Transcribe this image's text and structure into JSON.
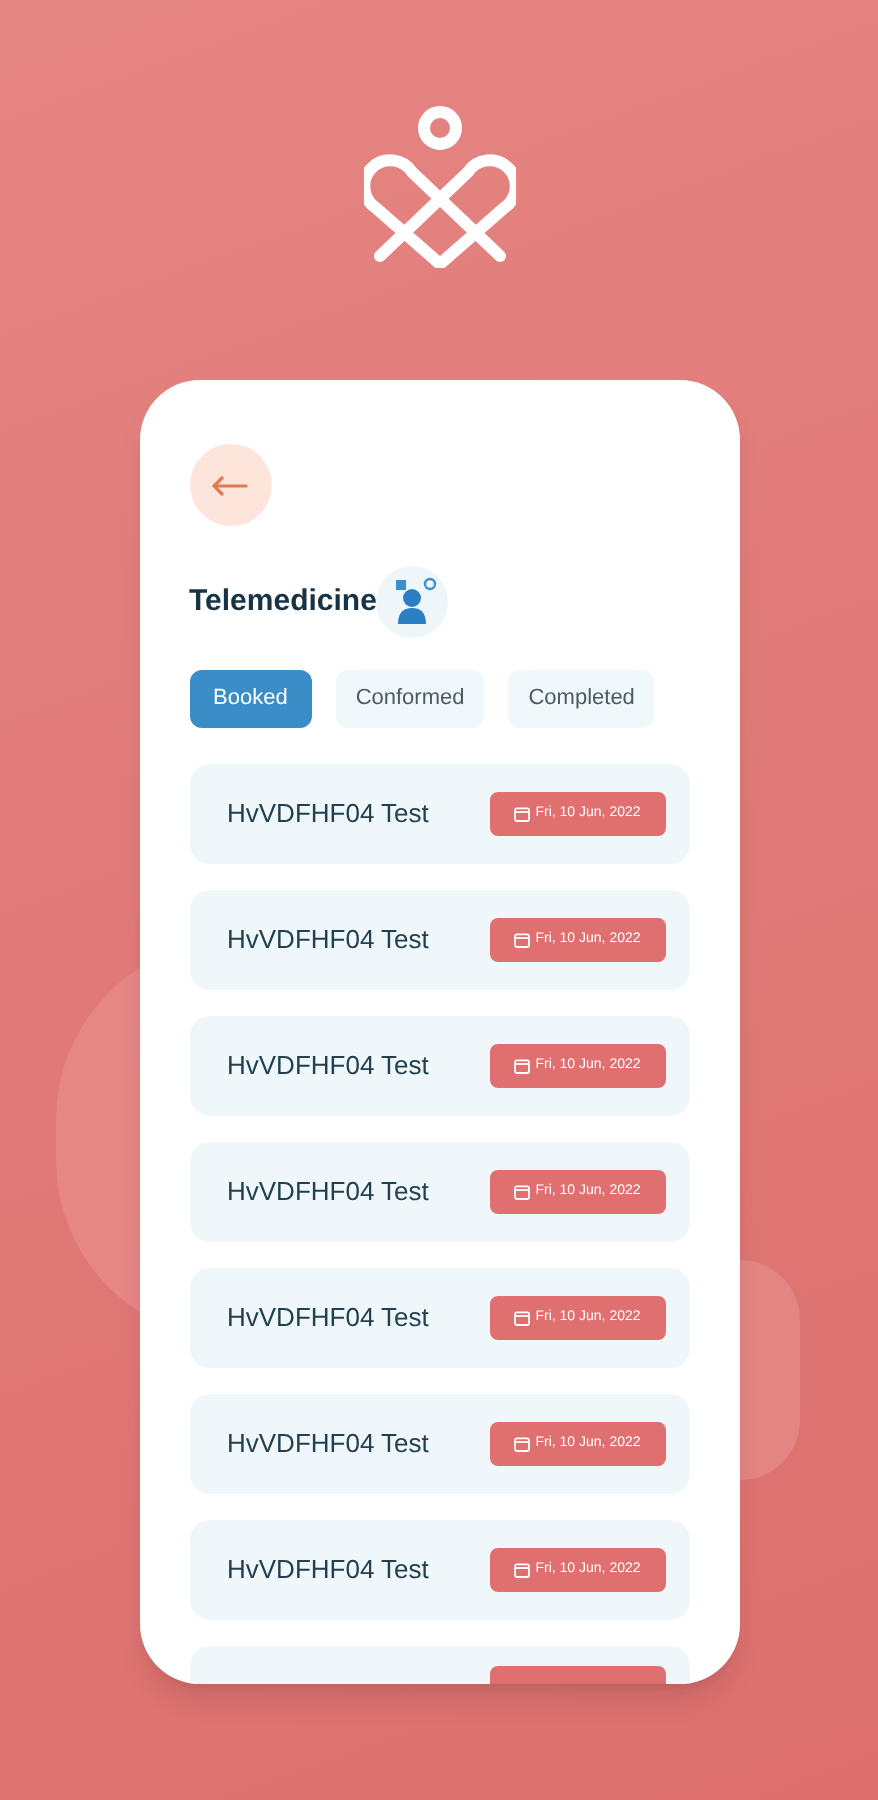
{
  "screen": {
    "title": "Telemedicine"
  },
  "tabs": [
    {
      "label": "Booked",
      "selected": true
    },
    {
      "label": "Conformed",
      "selected": false
    },
    {
      "label": "Completed",
      "selected": false
    }
  ],
  "appointments": [
    {
      "name": "HvVDFHF04 Test",
      "date": "Fri, 10 Jun, 2022"
    },
    {
      "name": "HvVDFHF04 Test",
      "date": "Fri, 10 Jun, 2022"
    },
    {
      "name": "HvVDFHF04 Test",
      "date": "Fri, 10 Jun, 2022"
    },
    {
      "name": "HvVDFHF04 Test",
      "date": "Fri, 10 Jun, 2022"
    },
    {
      "name": "HvVDFHF04 Test",
      "date": "Fri, 10 Jun, 2022"
    },
    {
      "name": "HvVDFHF04 Test",
      "date": "Fri, 10 Jun, 2022"
    },
    {
      "name": "HvVDFHF04 Test",
      "date": "Fri, 10 Jun, 2022"
    }
  ]
}
